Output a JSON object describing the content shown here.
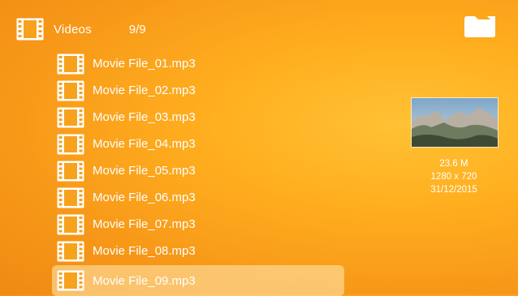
{
  "header": {
    "icon": "film-strip-icon",
    "title": "Videos",
    "count": "9/9"
  },
  "toolbar": {
    "folder_icon": "folder-icon"
  },
  "files": [
    {
      "name": "Movie File_01.mp3",
      "icon": "film-strip-icon",
      "selected": false
    },
    {
      "name": "Movie File_02.mp3",
      "icon": "film-strip-icon",
      "selected": false
    },
    {
      "name": "Movie File_03.mp3",
      "icon": "film-strip-icon",
      "selected": false
    },
    {
      "name": "Movie File_04.mp3",
      "icon": "film-strip-icon",
      "selected": false
    },
    {
      "name": "Movie File_05.mp3",
      "icon": "film-strip-icon",
      "selected": false
    },
    {
      "name": "Movie File_06.mp3",
      "icon": "film-strip-icon",
      "selected": false
    },
    {
      "name": "Movie File_07.mp3",
      "icon": "film-strip-icon",
      "selected": false
    },
    {
      "name": "Movie File_08.mp3",
      "icon": "film-strip-icon",
      "selected": false
    },
    {
      "name": "Movie File_09.mp3",
      "icon": "film-strip-icon",
      "selected": true
    }
  ],
  "preview": {
    "image": "mountain-landscape-thumbnail",
    "size": "23.6 M",
    "resolution": "1280 x 720",
    "date": "31/12/2015"
  },
  "colors": {
    "background": "#f8a01a",
    "text": "#ffffff",
    "selection": "#ffe7b0"
  }
}
